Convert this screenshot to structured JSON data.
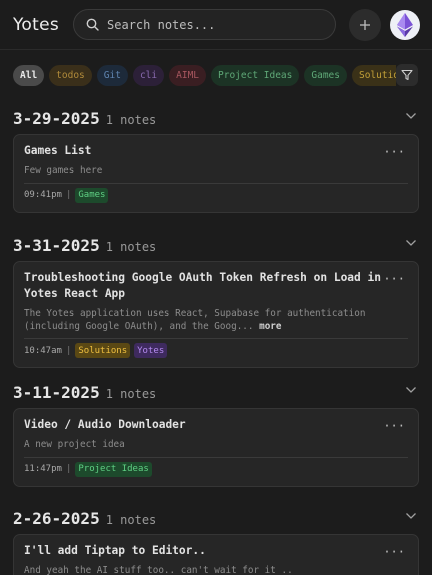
{
  "app": {
    "title": "Yotes"
  },
  "search": {
    "placeholder": "Search notes..."
  },
  "tags": [
    {
      "label": "All",
      "bg": "#4a4a4a",
      "fg": "#e8e8e8"
    },
    {
      "label": "todos",
      "bg": "#3a2f1a",
      "fg": "#b08a3a"
    },
    {
      "label": "Git",
      "bg": "#1d2a3a",
      "fg": "#5f84b0"
    },
    {
      "label": "cli",
      "bg": "#2c2038",
      "fg": "#8a6bb0"
    },
    {
      "label": "AIML",
      "bg": "#3a1e22",
      "fg": "#a8575f"
    },
    {
      "label": "Project Ideas",
      "bg": "#1c3325",
      "fg": "#5fa877"
    },
    {
      "label": "Games",
      "bg": "#1c3325",
      "fg": "#5fa877"
    },
    {
      "label": "Solutions",
      "bg": "#3a3118",
      "fg": "#c2a038"
    }
  ],
  "groups": [
    {
      "date": "3-29-2025",
      "count": "1 notes",
      "note": {
        "title": "Games List",
        "body": "Few games here",
        "more": "",
        "time": "09:41pm",
        "tags": [
          {
            "label": "Games",
            "bg": "#1d4a2c",
            "fg": "#5fd084"
          }
        ]
      }
    },
    {
      "date": "3-31-2025",
      "count": "1 notes",
      "note": {
        "title": "Troubleshooting Google OAuth Token Refresh on Load in Yotes React App",
        "body": "The Yotes application uses React, Supabase for authentication (including Google OAuth), and the Goog...",
        "more": "more",
        "time": "10:47am",
        "tags": [
          {
            "label": "Solutions",
            "bg": "#5a4814",
            "fg": "#f0c040"
          },
          {
            "label": "Yotes",
            "bg": "#3e2a5e",
            "fg": "#b48af0"
          }
        ]
      }
    },
    {
      "date": "3-11-2025",
      "count": "1 notes",
      "note": {
        "title": "Video / Audio Downloader",
        "body": "A new project idea",
        "more": "",
        "time": "11:47pm",
        "tags": [
          {
            "label": "Project Ideas",
            "bg": "#1d4a2c",
            "fg": "#5fd084"
          }
        ]
      }
    },
    {
      "date": "2-26-2025",
      "count": "1 notes",
      "note": {
        "title": "I'll add Tiptap to Editor..",
        "body": "And yeah the AI stuff too.. can't wait for it ..",
        "more": "",
        "time": "",
        "tags": []
      }
    }
  ]
}
